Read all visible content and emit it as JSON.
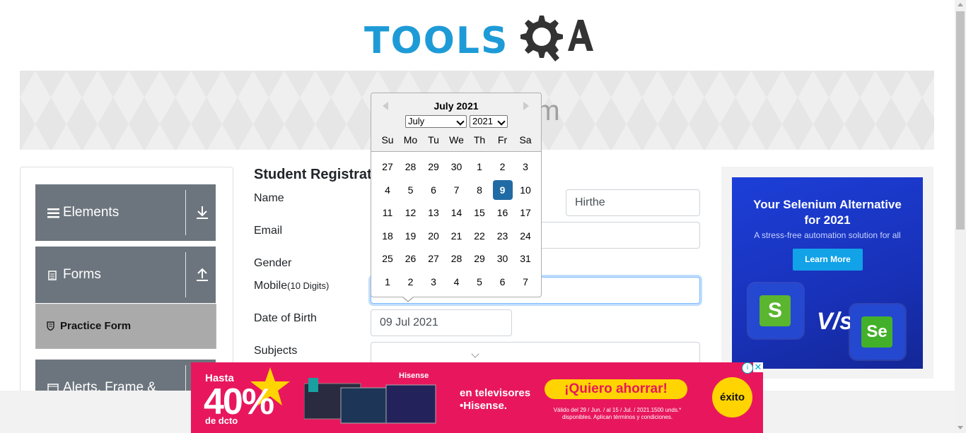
{
  "logo": {
    "text": "TOOLS",
    "qa": "QA"
  },
  "banner": {
    "title_visible": "rm"
  },
  "sidebar": {
    "groups": [
      {
        "label": "Elements",
        "icon": "hamburger-icon",
        "arrow": "download-arrow-icon"
      },
      {
        "label": "Forms",
        "icon": "document-icon",
        "arrow": "upload-arrow-icon"
      },
      {
        "label": "Alerts, Frame &",
        "icon": "window-icon",
        "arrow": ""
      }
    ],
    "active_item": "Practice Form"
  },
  "form": {
    "title": "Student Registratio",
    "name_label": "Name",
    "name_value": "Hirthe",
    "email_label": "Email",
    "gender_label": "Gender",
    "mobile_label": "Mobile",
    "mobile_hint": "(10 Digits)",
    "dob_label": "Date of Birth",
    "dob_value": "09 Jul 2021",
    "subjects_label": "Subjects"
  },
  "calendar": {
    "month_title": "July 2021",
    "month_select": "July",
    "year_select": "2021",
    "day_names": [
      "Su",
      "Mo",
      "Tu",
      "We",
      "Th",
      "Fr",
      "Sa"
    ],
    "weeks": [
      [
        "27",
        "28",
        "29",
        "30",
        "1",
        "2",
        "3"
      ],
      [
        "4",
        "5",
        "6",
        "7",
        "8",
        "9",
        "10"
      ],
      [
        "11",
        "12",
        "13",
        "14",
        "15",
        "16",
        "17"
      ],
      [
        "18",
        "19",
        "20",
        "21",
        "22",
        "23",
        "24"
      ],
      [
        "25",
        "26",
        "27",
        "28",
        "29",
        "30",
        "31"
      ],
      [
        "1",
        "2",
        "3",
        "4",
        "5",
        "6",
        "7"
      ]
    ],
    "selected_day": "9",
    "selected_color": "#216ba5"
  },
  "right_ad": {
    "headline1": "Your Selenium Alternative",
    "headline2": "for 2021",
    "subline": "A stress-free automation solution for all",
    "button": "Learn More",
    "vs": "V/s",
    "left_logo": "S",
    "right_logo": "Se"
  },
  "bottom_ad": {
    "hasta": "Hasta",
    "percent": "40%",
    "dcto": "de dcto",
    "brand": "Hisense",
    "line1": "en televisores",
    "line2": "•Hisense.",
    "cta": "¡Quiero ahorrar!",
    "legal1": "Válido del 29 / Jun. / al 15 / Jul. / 2021.1500 unds.*",
    "legal2": "disponibles. Aplican términos y condiciones.",
    "store": "éxito",
    "info": "i",
    "close": "✕"
  },
  "colors": {
    "accent": "#1e9bd7",
    "sidebar": "#6c757d",
    "ad_pink": "#e8175d",
    "ad_yellow": "#ffd400"
  }
}
